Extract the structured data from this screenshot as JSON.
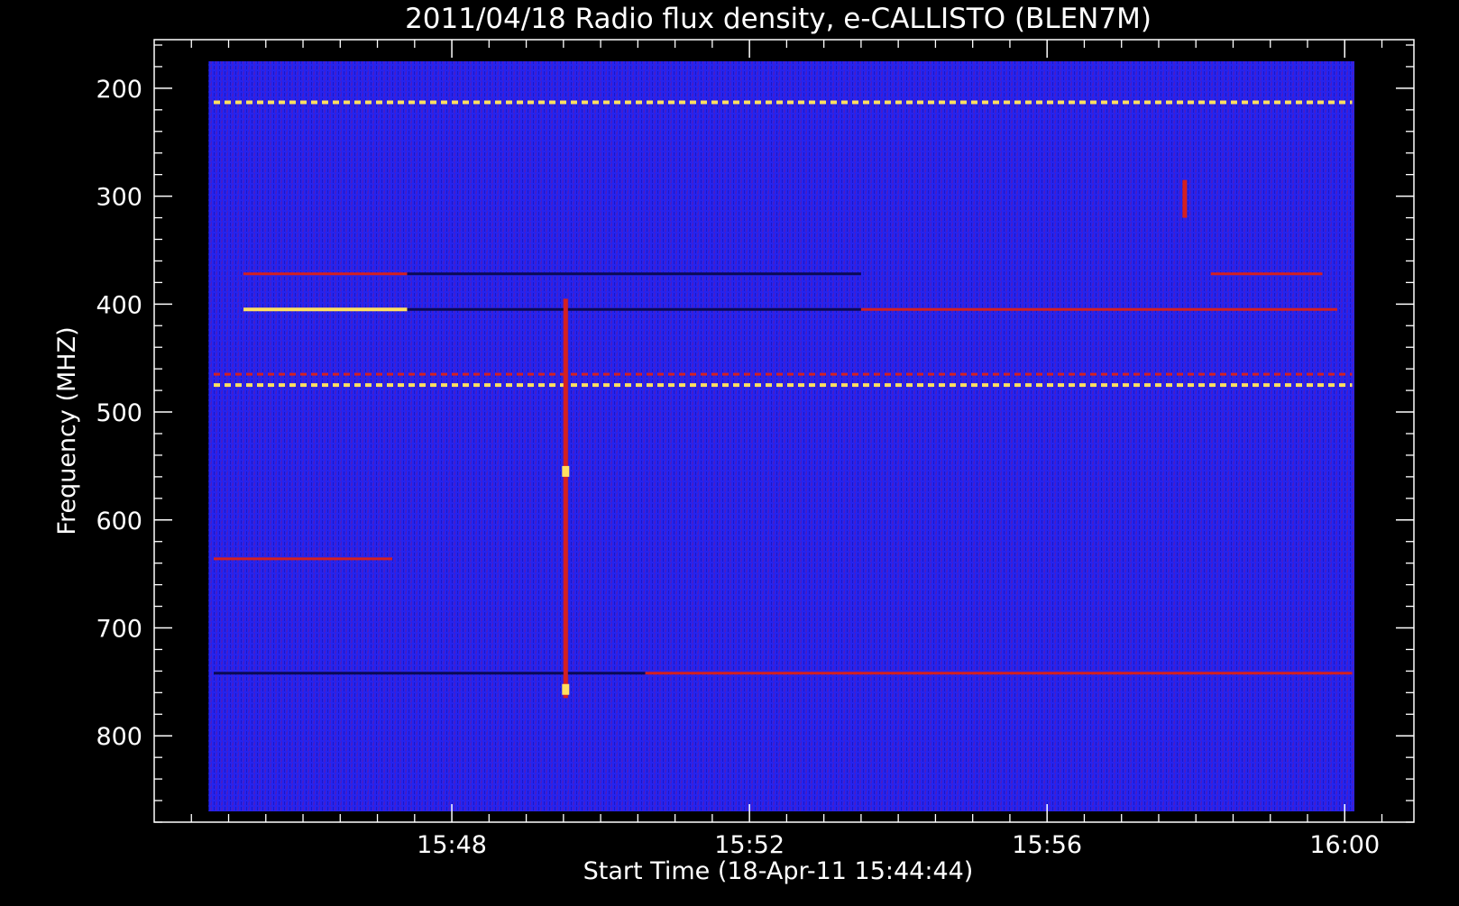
{
  "chart_data": {
    "type": "heatmap",
    "title": "2011/04/18  Radio flux density, e-CALLISTO (BLEN7M)",
    "xlabel": "Start Time (18-Apr-11 15:44:44)",
    "ylabel": "Frequency (MHZ)",
    "x_ticks": [
      "15:48",
      "15:52",
      "15:56",
      "16:00"
    ],
    "y_ticks": [
      "200",
      "300",
      "400",
      "500",
      "600",
      "700",
      "800"
    ],
    "x_tick_minutes": [
      48,
      52,
      56,
      60
    ],
    "y_tick_values": [
      200,
      300,
      400,
      500,
      600,
      700,
      800
    ],
    "xlim_minutes": [
      44.73,
      60.13
    ],
    "plot_xlim_minutes": [
      44.0,
      60.93
    ],
    "ylim_mhz": [
      175,
      870
    ],
    "plot_ylim_mhz": [
      155,
      880
    ],
    "y_inverted": true,
    "colormap": {
      "background": "#2222ee",
      "low": "#0a0a55",
      "mid": "#d42020",
      "high": "#ffe060"
    },
    "features": [
      {
        "kind": "band",
        "freq": 213,
        "t_start": 44.8,
        "t_end": 60.1,
        "level": "high",
        "dashed": true
      },
      {
        "kind": "band",
        "freq": 405,
        "t_start": 45.2,
        "t_end": 47.4,
        "level": "high"
      },
      {
        "kind": "band",
        "freq": 372,
        "t_start": 45.2,
        "t_end": 47.4,
        "level": "mid"
      },
      {
        "kind": "band",
        "freq": 405,
        "t_start": 47.4,
        "t_end": 53.5,
        "level": "low"
      },
      {
        "kind": "band",
        "freq": 372,
        "t_start": 47.4,
        "t_end": 53.5,
        "level": "low"
      },
      {
        "kind": "band",
        "freq": 405,
        "t_start": 53.5,
        "t_end": 59.9,
        "level": "mid"
      },
      {
        "kind": "band",
        "freq": 372,
        "t_start": 58.2,
        "t_end": 59.7,
        "level": "mid"
      },
      {
        "kind": "band",
        "freq": 475,
        "t_start": 44.8,
        "t_end": 60.1,
        "level": "high",
        "dashed": true
      },
      {
        "kind": "band",
        "freq": 465,
        "t_start": 44.8,
        "t_end": 60.1,
        "level": "mid",
        "dashed": true
      },
      {
        "kind": "band",
        "freq": 742,
        "t_start": 44.8,
        "t_end": 50.6,
        "level": "low"
      },
      {
        "kind": "band",
        "freq": 742,
        "t_start": 50.6,
        "t_end": 60.1,
        "level": "mid"
      },
      {
        "kind": "band",
        "freq": 636,
        "t_start": 44.8,
        "t_end": 47.2,
        "level": "mid"
      },
      {
        "kind": "burst",
        "time": 49.53,
        "f_start": 395,
        "f_end": 765,
        "level": "mid"
      },
      {
        "kind": "burst",
        "time": 49.53,
        "f_start": 550,
        "f_end": 560,
        "level": "high"
      },
      {
        "kind": "burst",
        "time": 49.53,
        "f_start": 752,
        "f_end": 762,
        "level": "high"
      },
      {
        "kind": "burst",
        "time": 57.85,
        "f_start": 285,
        "f_end": 320,
        "level": "mid"
      }
    ]
  }
}
